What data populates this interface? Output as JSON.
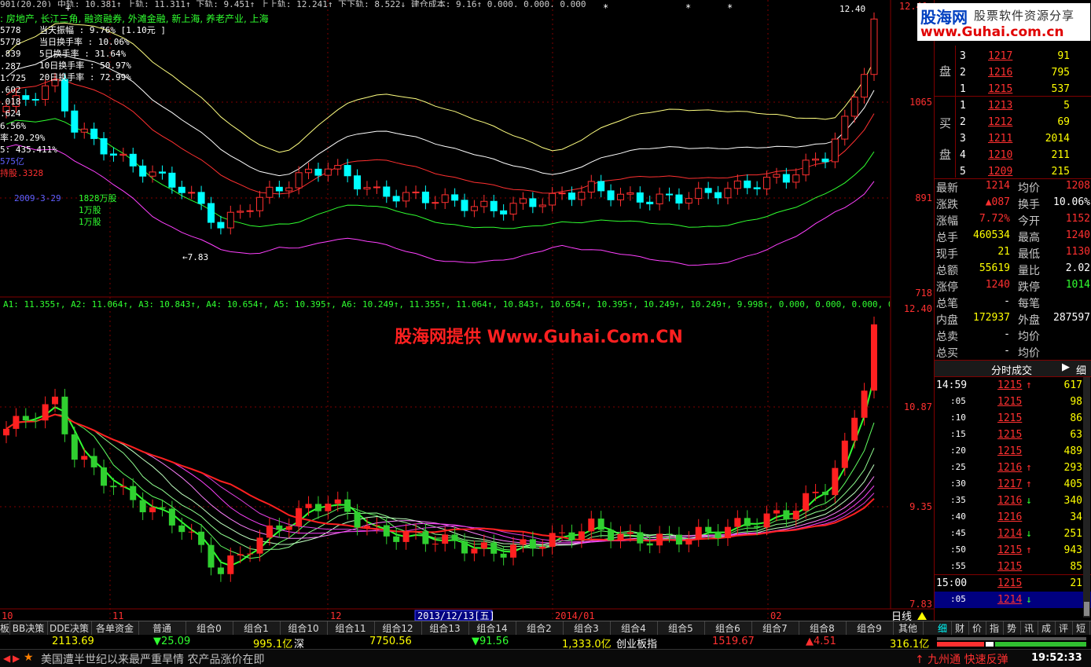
{
  "logo": {
    "site_cn": "股海网",
    "slogan": "股票软件资源分享",
    "url": "www.Guhai.com.cn"
  },
  "watermark": "股海网提供 Www.Guhai.Com.CN",
  "top_indicator_row": "901(20,20)  中轨: 10.381↑  上轨: 11.311↑  下轨: 9.451↑  上上轨: 12.241↑  下下轨: 8.522↓  建仓成本: 9.16↑  0.000, 0.000, 0.000",
  "concept_line": ": 房地产, 长江三角, 融资融券, 外滩金融, 新上海, 养老产业, 上海",
  "info_box": [
    {
      "label": "当天振幅",
      "value": ": 9.76% [1.10元 ]"
    },
    {
      "label": "当日换手率",
      "value": ": 10.06%"
    },
    {
      "label": "5日换手率",
      "value": ": 31.64%"
    },
    {
      "label": "10日换手率",
      "value": ": 50.97%"
    },
    {
      "label": "20日换手率",
      "value": ": 72.99%"
    }
  ],
  "left_values": [
    "5778",
    "5778",
    ".839",
    ".287",
    "1.725",
    ".602",
    ".018",
    ".624",
    "6.56%",
    "率:20.29%",
    "5: 435.411%",
    "575亿",
    "持股.3328"
  ],
  "main_annotations": {
    "date_label": "2009-3-29",
    "vol1": "1828万股",
    "vol2": "1万股",
    "vol3": "1万股",
    "low_label": "←7.83",
    "high_label": "12.40"
  },
  "main_yaxis": [
    "12.40",
    "1065",
    "891",
    "718"
  ],
  "sub_indicator_row": "A1: 11.355↑, A2: 11.064↑, A3: 10.843↑, A4: 10.654↑, A5: 10.395↑, A6: 10.249↑, 11.355↑, 11.064↑, 10.843↑, 10.654↑, 10.395↑, 10.249↑, 10.249↑, 9.998↑, 0.000, 0.000, 0.000, 0.000, 0.000, 0.000, 0.",
  "sub_yaxis": [
    "12.40",
    "10.87",
    "9.35",
    "7.83"
  ],
  "xaxis": {
    "labels": [
      "10",
      "11",
      "12",
      "2013/12/13[五]",
      "2014/01",
      "02"
    ],
    "day_line": "日线"
  },
  "orderbook": {
    "sell": [
      {
        "lvl": "3",
        "price": "1217",
        "vol": "91"
      },
      {
        "lvl": "2",
        "price": "1216",
        "vol": "795"
      },
      {
        "lvl": "1",
        "price": "1215",
        "vol": "537"
      }
    ],
    "buy": [
      {
        "lvl": "1",
        "price": "1213",
        "vol": "5"
      },
      {
        "lvl": "2",
        "price": "1212",
        "vol": "69"
      },
      {
        "lvl": "3",
        "price": "1211",
        "vol": "2014"
      },
      {
        "lvl": "4",
        "price": "1210",
        "vol": "211"
      },
      {
        "lvl": "5",
        "price": "1209",
        "vol": "215"
      }
    ],
    "sell_label": [
      "盘"
    ],
    "buy_label": [
      "买",
      "盘"
    ]
  },
  "stats": [
    {
      "l1": "最新",
      "v1": "1214",
      "l2": "均价",
      "v2": "1208"
    },
    {
      "l1": "涨跌",
      "v1": "▲087",
      "l2": "换手",
      "v2": "10.06%"
    },
    {
      "l1": "涨幅",
      "v1": "7.72%",
      "l2": "今开",
      "v2": "1152"
    },
    {
      "l1": "总手",
      "v1": "460534",
      "l2": "最高",
      "v2": "1240"
    },
    {
      "l1": "现手",
      "v1": "21",
      "l2": "最低",
      "v2": "1130"
    },
    {
      "l1": "总额",
      "v1": "55619",
      "l2": "量比",
      "v2": "2.02"
    },
    {
      "l1": "涨停",
      "v1": "1240",
      "l2": "跌停",
      "v2": "1014"
    },
    {
      "l1": "总笔",
      "v1": "-",
      "l2": "每笔",
      "v2": ""
    },
    {
      "l1": "内盘",
      "v1": "172937",
      "l2": "外盘",
      "v2": "287597"
    },
    {
      "l1": "总卖",
      "v1": "-",
      "l2": "均价",
      "v2": ""
    },
    {
      "l1": "总买",
      "v1": "-",
      "l2": "均价",
      "v2": ""
    }
  ],
  "ticks_header": {
    "title": "分时成交",
    "btn": "细"
  },
  "ticks": [
    {
      "t": "14:59",
      "p": "1215",
      "a": "↑",
      "v": "617"
    },
    {
      "t": ":05",
      "p": "1215",
      "a": "",
      "v": "98"
    },
    {
      "t": ":10",
      "p": "1215",
      "a": "",
      "v": "86"
    },
    {
      "t": ":15",
      "p": "1215",
      "a": "",
      "v": "63"
    },
    {
      "t": ":20",
      "p": "1215",
      "a": "",
      "v": "489"
    },
    {
      "t": ":25",
      "p": "1216",
      "a": "↑",
      "v": "293"
    },
    {
      "t": ":30",
      "p": "1217",
      "a": "↑",
      "v": "405"
    },
    {
      "t": ":35",
      "p": "1216",
      "a": "↓",
      "v": "340"
    },
    {
      "t": ":40",
      "p": "1216",
      "a": "",
      "v": "34"
    },
    {
      "t": ":45",
      "p": "1214",
      "a": "↓",
      "v": "251"
    },
    {
      "t": ":50",
      "p": "1215",
      "a": "↑",
      "v": "943"
    },
    {
      "t": ":55",
      "p": "1215",
      "a": "",
      "v": "85"
    },
    {
      "t": "15:00",
      "p": "1215",
      "a": "",
      "v": "21"
    },
    {
      "t": ":05",
      "p": "1214",
      "a": "↓",
      "v": ""
    }
  ],
  "tabs": [
    "板",
    "BB决策",
    "DDE决策",
    "各单资金",
    "普通",
    "组合0",
    "组合1",
    "组合10",
    "组合11",
    "组合12",
    "组合13",
    "组合14",
    "组合2",
    "组合3",
    "组合4",
    "组合5",
    "组合6",
    "组合7",
    "组合8",
    "组合9",
    "其他"
  ],
  "right_tabs": [
    "细",
    "财",
    "价",
    "指",
    "势",
    "讯",
    "成",
    "评",
    "短"
  ],
  "indexbar": {
    "sh_val": "2113.69",
    "sh_chg": "▼25.09",
    "sh_amt": "995.1亿",
    "sz_name": "深",
    "sz_val": "7750.56",
    "sz_chg": "▼91.56",
    "sz_amt": "1,333.0亿",
    "cy_name": "创业板指",
    "cy_val": "1519.67",
    "cy_chg": "▲4.51",
    "cy_amt": "316.1亿"
  },
  "news": {
    "headline": "美国遭半世纪以来最严重旱情 农产品涨价在即",
    "ticker": "↑ 九州通  快速反弹",
    "time": "19:52:33"
  },
  "colors": {
    "up": "#ff3030",
    "down": "#00ffff",
    "axis": "#800000",
    "yellow": "#ffff00",
    "green": "#30ff30"
  }
}
